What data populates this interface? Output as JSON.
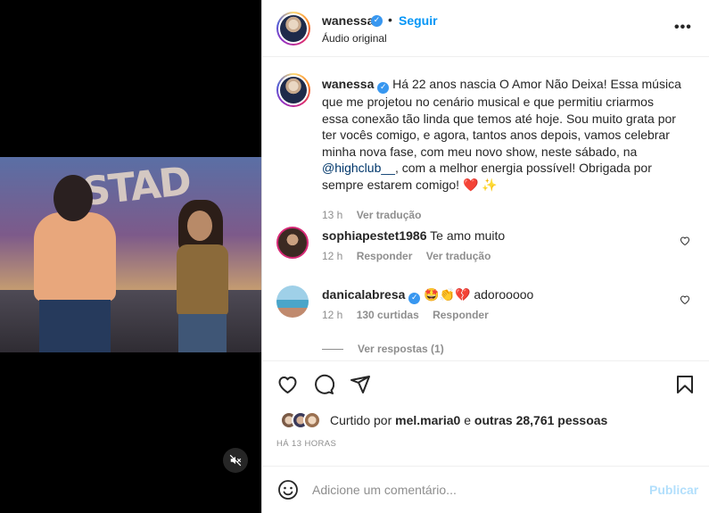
{
  "media": {
    "mute_icon": "speaker-muted-icon"
  },
  "header": {
    "username": "wanessa",
    "separator": "•",
    "follow_label": "Seguir",
    "audio_label": "Áudio original",
    "more_icon": "more-options-icon"
  },
  "caption": {
    "username": "wanessa",
    "text_before_mention": "Há 22 anos nascia O Amor Não Deixa! Essa música que me projetou no cenário musical e que permitiu criarmos essa conexão tão linda que temos até hoje. Sou muito grata por ter vocês comigo, e agora, tantos anos depois, vamos celebrar minha nova fase, com meu novo show, neste sábado, na ",
    "mention": "@highclub__",
    "text_after_mention": ", com a melhor energia possível! Obrigada por sempre estarem comigo! ",
    "emojis": "❤️ ✨",
    "time": "13 h",
    "translate_label": "Ver tradução"
  },
  "comments": [
    {
      "username": "sophiapestet1986",
      "text": "Te amo muito",
      "time": "12 h",
      "reply_label": "Responder",
      "translate_label": "Ver tradução"
    },
    {
      "username": "danicalabresa",
      "text": "🤩👏💔 adorooooo",
      "time": "12 h",
      "likes_label": "130 curtidas",
      "reply_label": "Responder"
    }
  ],
  "replies_label": "Ver respostas (1)",
  "likes": {
    "prefix": "Curtido por ",
    "user": "mel.maria0",
    "middle": " e ",
    "others": "outras 28,761 pessoas"
  },
  "timestamp": "HÁ 13 HORAS",
  "add_comment": {
    "placeholder": "Adicione um comentário...",
    "post_label": "Publicar"
  },
  "colors": {
    "accent": "#0095f6",
    "verified": "#3897f0",
    "post_disabled": "#b2dffc",
    "muted_text": "#8e8e8e"
  }
}
